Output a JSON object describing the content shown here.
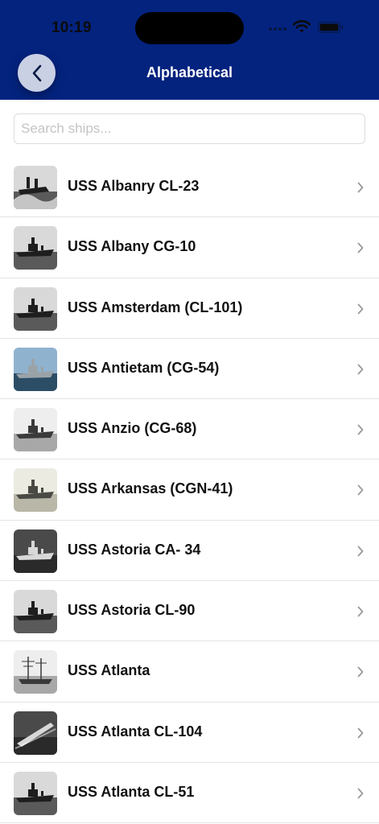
{
  "status_bar": {
    "time": "10:19"
  },
  "nav": {
    "title": "Alphabetical",
    "back_icon": "chevron-left-icon"
  },
  "search": {
    "placeholder": "Search ships...",
    "value": ""
  },
  "ships": [
    {
      "name": "USS Albanry CL-23",
      "thumb_tone": "grey",
      "thumb_kind": "rough-sea"
    },
    {
      "name": "USS Albany CG-10",
      "thumb_tone": "grey",
      "thumb_kind": "cruiser"
    },
    {
      "name": "USS Amsterdam (CL-101)",
      "thumb_tone": "grey",
      "thumb_kind": "cruiser"
    },
    {
      "name": "USS Antietam (CG-54)",
      "thumb_tone": "color",
      "thumb_kind": "modern"
    },
    {
      "name": "USS Anzio (CG-68)",
      "thumb_tone": "pale",
      "thumb_kind": "modern"
    },
    {
      "name": "USS Arkansas (CGN-41)",
      "thumb_tone": "sepia",
      "thumb_kind": "modern"
    },
    {
      "name": "USS Astoria CA- 34",
      "thumb_tone": "dark",
      "thumb_kind": "cruiser"
    },
    {
      "name": "USS Astoria CL-90",
      "thumb_tone": "grey",
      "thumb_kind": "cruiser"
    },
    {
      "name": "USS Atlanta",
      "thumb_tone": "pale",
      "thumb_kind": "sailing"
    },
    {
      "name": "USS Atlanta CL-104",
      "thumb_tone": "dark",
      "thumb_kind": "aerial"
    },
    {
      "name": "USS Atlanta CL-51",
      "thumb_tone": "grey",
      "thumb_kind": "cruiser"
    }
  ]
}
